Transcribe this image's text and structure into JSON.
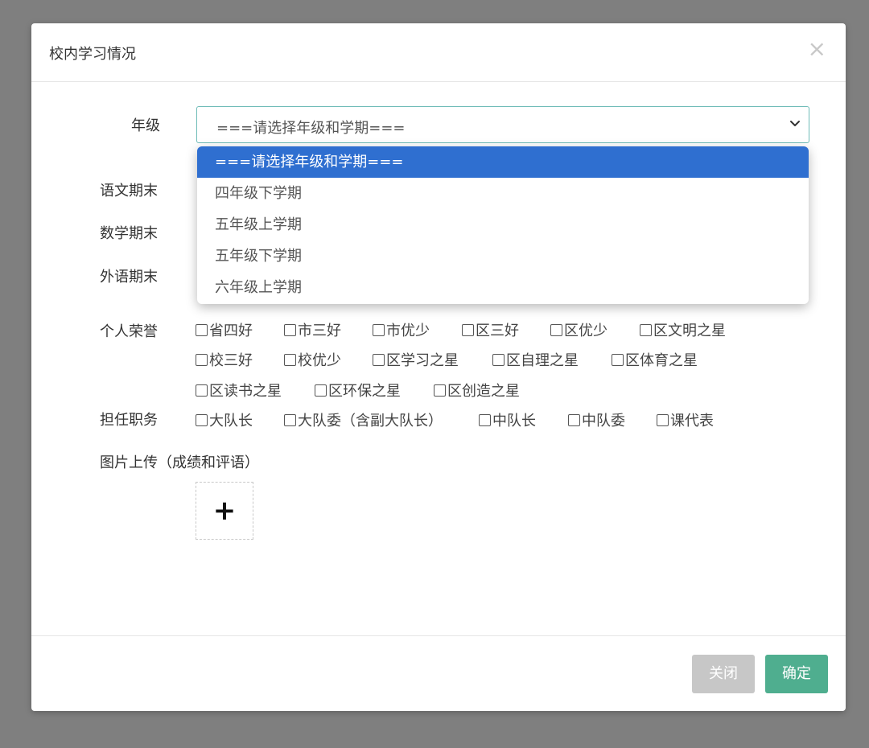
{
  "modal": {
    "title": "校内学习情况",
    "close_icon": "close-icon"
  },
  "form": {
    "grade_label": "年级",
    "grade_select": {
      "value": "===请选择年级和学期===",
      "options": [
        "===请选择年级和学期===",
        "四年级下学期",
        "五年级上学期",
        "五年级下学期",
        "六年级上学期"
      ],
      "highlighted_index": 0
    },
    "chinese_label": "语文期末",
    "math_label": "数学期末",
    "foreign_label": "外语期末",
    "honors_label": "个人荣誉",
    "honors": [
      "省四好",
      "市三好",
      "市优少",
      "区三好",
      "区优少",
      "区文明之星",
      "校三好",
      "校优少",
      "区学习之星",
      "区自理之星",
      "区体育之星",
      "区读书之星",
      "区环保之星",
      "区创造之星"
    ],
    "duties_label": "担任职务",
    "duties": [
      "大队长",
      "大队委（含副大队长）",
      "中队长",
      "中队委",
      "课代表"
    ],
    "upload_label": "图片上传（成绩和评语）",
    "upload_icon": "plus-icon"
  },
  "footer": {
    "close_label": "关闭",
    "confirm_label": "确定"
  },
  "colors": {
    "selected_option": "#2f6fd0",
    "confirm_button": "#4fae8f",
    "close_button": "#c7c7c7",
    "select_border": "#6fbcb8"
  }
}
